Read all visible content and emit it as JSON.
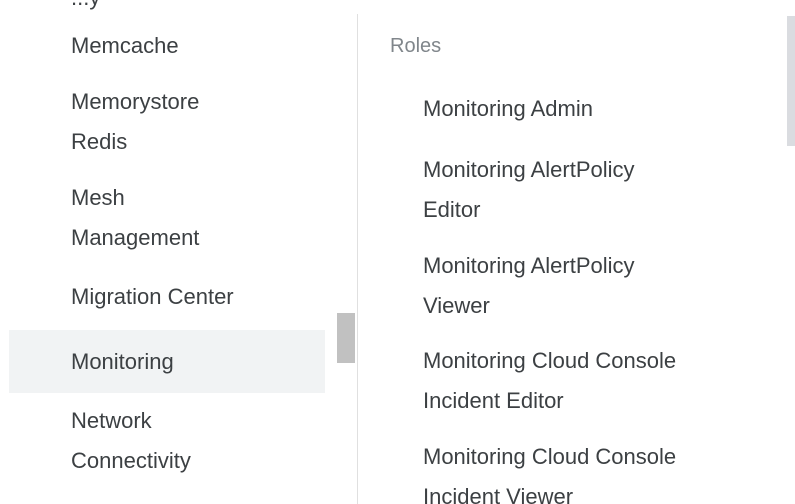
{
  "service_list": {
    "partial_top_label": "...y",
    "items": [
      {
        "label": "Memcache"
      },
      {
        "label_line1": "Memorystore",
        "label_line2": "Redis"
      },
      {
        "label_line1": "Mesh",
        "label_line2": "Management"
      },
      {
        "label": "Migration Center"
      },
      {
        "label": "Monitoring",
        "selected": true
      },
      {
        "label_line1": "Network",
        "label_line2": "Connectivity"
      }
    ]
  },
  "roles_panel": {
    "header": "Roles",
    "items": [
      {
        "label": "Monitoring Admin"
      },
      {
        "label_line1": "Monitoring AlertPolicy",
        "label_line2": "Editor"
      },
      {
        "label_line1": "Monitoring AlertPolicy",
        "label_line2": "Viewer"
      },
      {
        "label_line1": "Monitoring Cloud Console",
        "label_line2": "Incident Editor"
      },
      {
        "label_line1": "Monitoring Cloud Console",
        "label_line2": "Incident Viewer"
      }
    ]
  },
  "colors": {
    "selected_background": "#f1f3f4",
    "text": "#3c4043",
    "header_text": "#80868b"
  }
}
